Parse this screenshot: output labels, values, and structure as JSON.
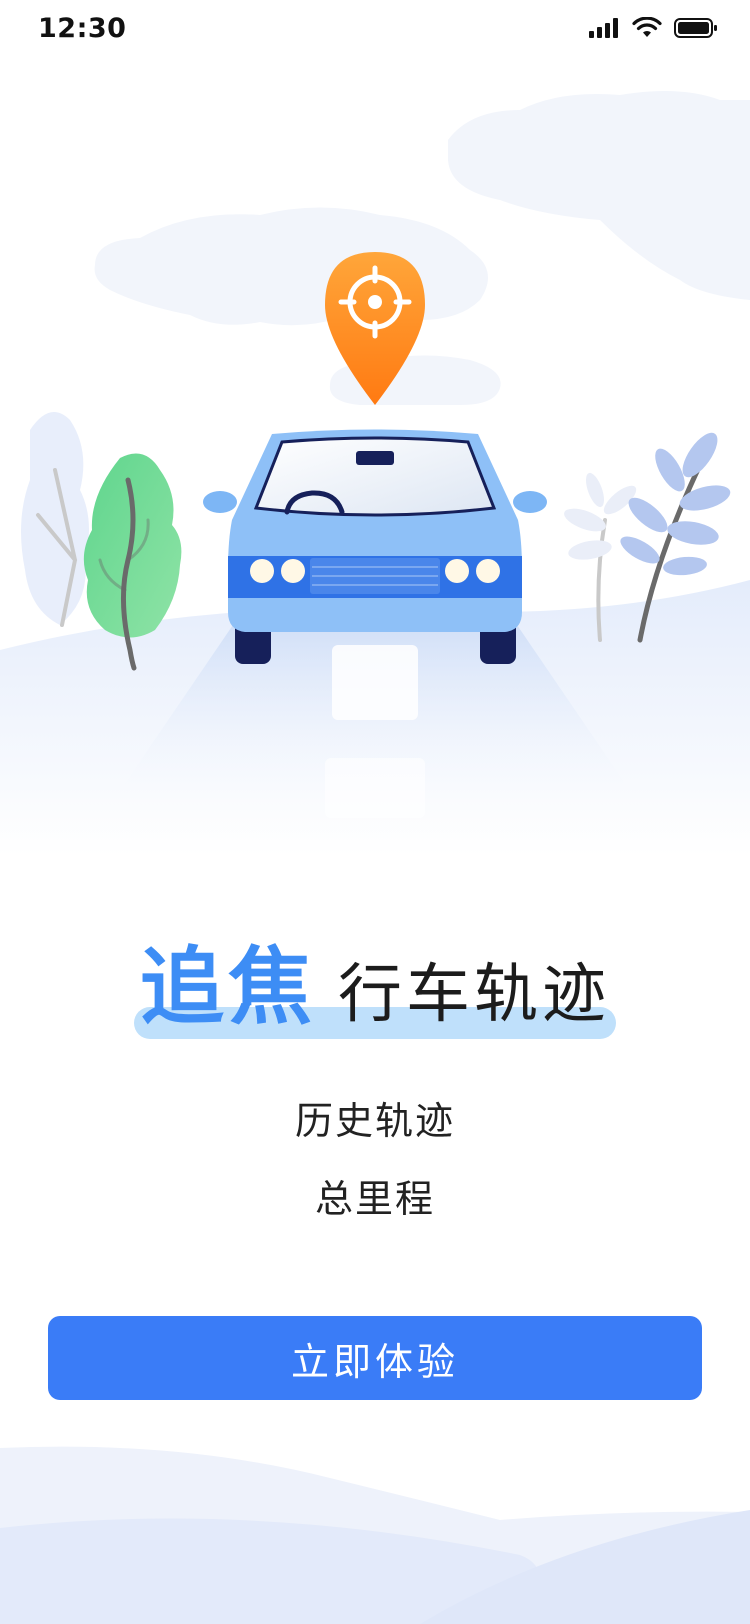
{
  "status_bar": {
    "time": "12:30",
    "icons": [
      "cellular-signal-icon",
      "wifi-icon",
      "battery-icon"
    ]
  },
  "hero": {
    "illustration": "car-on-road-with-location-pin",
    "colors": {
      "car": "#7db6f5",
      "pin": "#ff8a1f",
      "sky": "#eef3fc"
    }
  },
  "headline": {
    "accent": "追焦",
    "rest": "行车轨迹"
  },
  "features": [
    "历史轨迹",
    "总里程"
  ],
  "cta": {
    "label": "立即体验",
    "color": "#3a7cf7"
  }
}
